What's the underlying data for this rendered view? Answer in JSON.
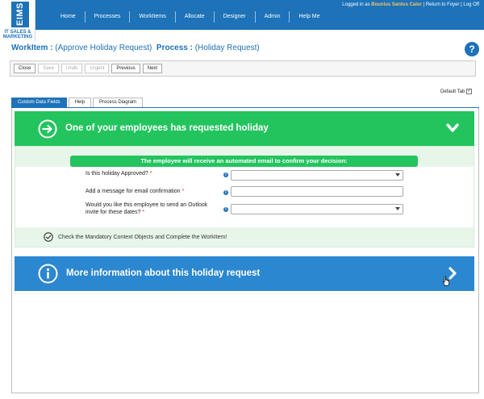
{
  "header": {
    "logo": {
      "brand": "EIMS",
      "sub1": "IT SALES &",
      "sub2": "MARKETING"
    },
    "nav": [
      "Home",
      "Processes",
      "WorkItems",
      "Allocate",
      "Designer",
      "Admin",
      "Help Me"
    ],
    "user": {
      "prefix": "Logged in as ",
      "name": "Bounius Santos Calor",
      "return_link": "Return to Foyer",
      "sep": " | ",
      "logoff": "Log Off"
    }
  },
  "title": {
    "workitem_label": "WorkItem :",
    "workitem_value": " (Approve Holiday Request)",
    "process_label": "Process :",
    "process_value": " (Holiday Request)",
    "help": "?"
  },
  "toolbar": {
    "close": "Close",
    "save": "Save",
    "undo": "Undo",
    "urgent": "Urgent",
    "previous": "Previous",
    "next": "Next"
  },
  "default_tab": {
    "label": "Default Tab",
    "checked": true
  },
  "tabs": [
    "Custom Data Fields",
    "Help",
    "Process Diagram"
  ],
  "green_panel": {
    "title": "One of your employees has requested holiday",
    "banner": "The employee will receive an automated email to confirm your decision:",
    "fields": [
      {
        "label": "Is this holiday Approved?",
        "required": " *",
        "type": "select",
        "value": ""
      },
      {
        "label": "Add a message for email confirmation",
        "required": " *",
        "type": "text",
        "value": ""
      },
      {
        "label1": "Would you like this employee to send an Outlook",
        "label2": "invite for these dates?",
        "required": " *",
        "type": "select",
        "value": ""
      }
    ],
    "status": "Check the Mandatory Context Objects and Complete the WorkItem!"
  },
  "blue_panel": {
    "title": "More information about this holiday request"
  },
  "colors": {
    "brand_blue": "#1d72b8",
    "green": "#23c45e",
    "panel_blue": "#2b87cf",
    "user_name": "#f7c35d"
  }
}
